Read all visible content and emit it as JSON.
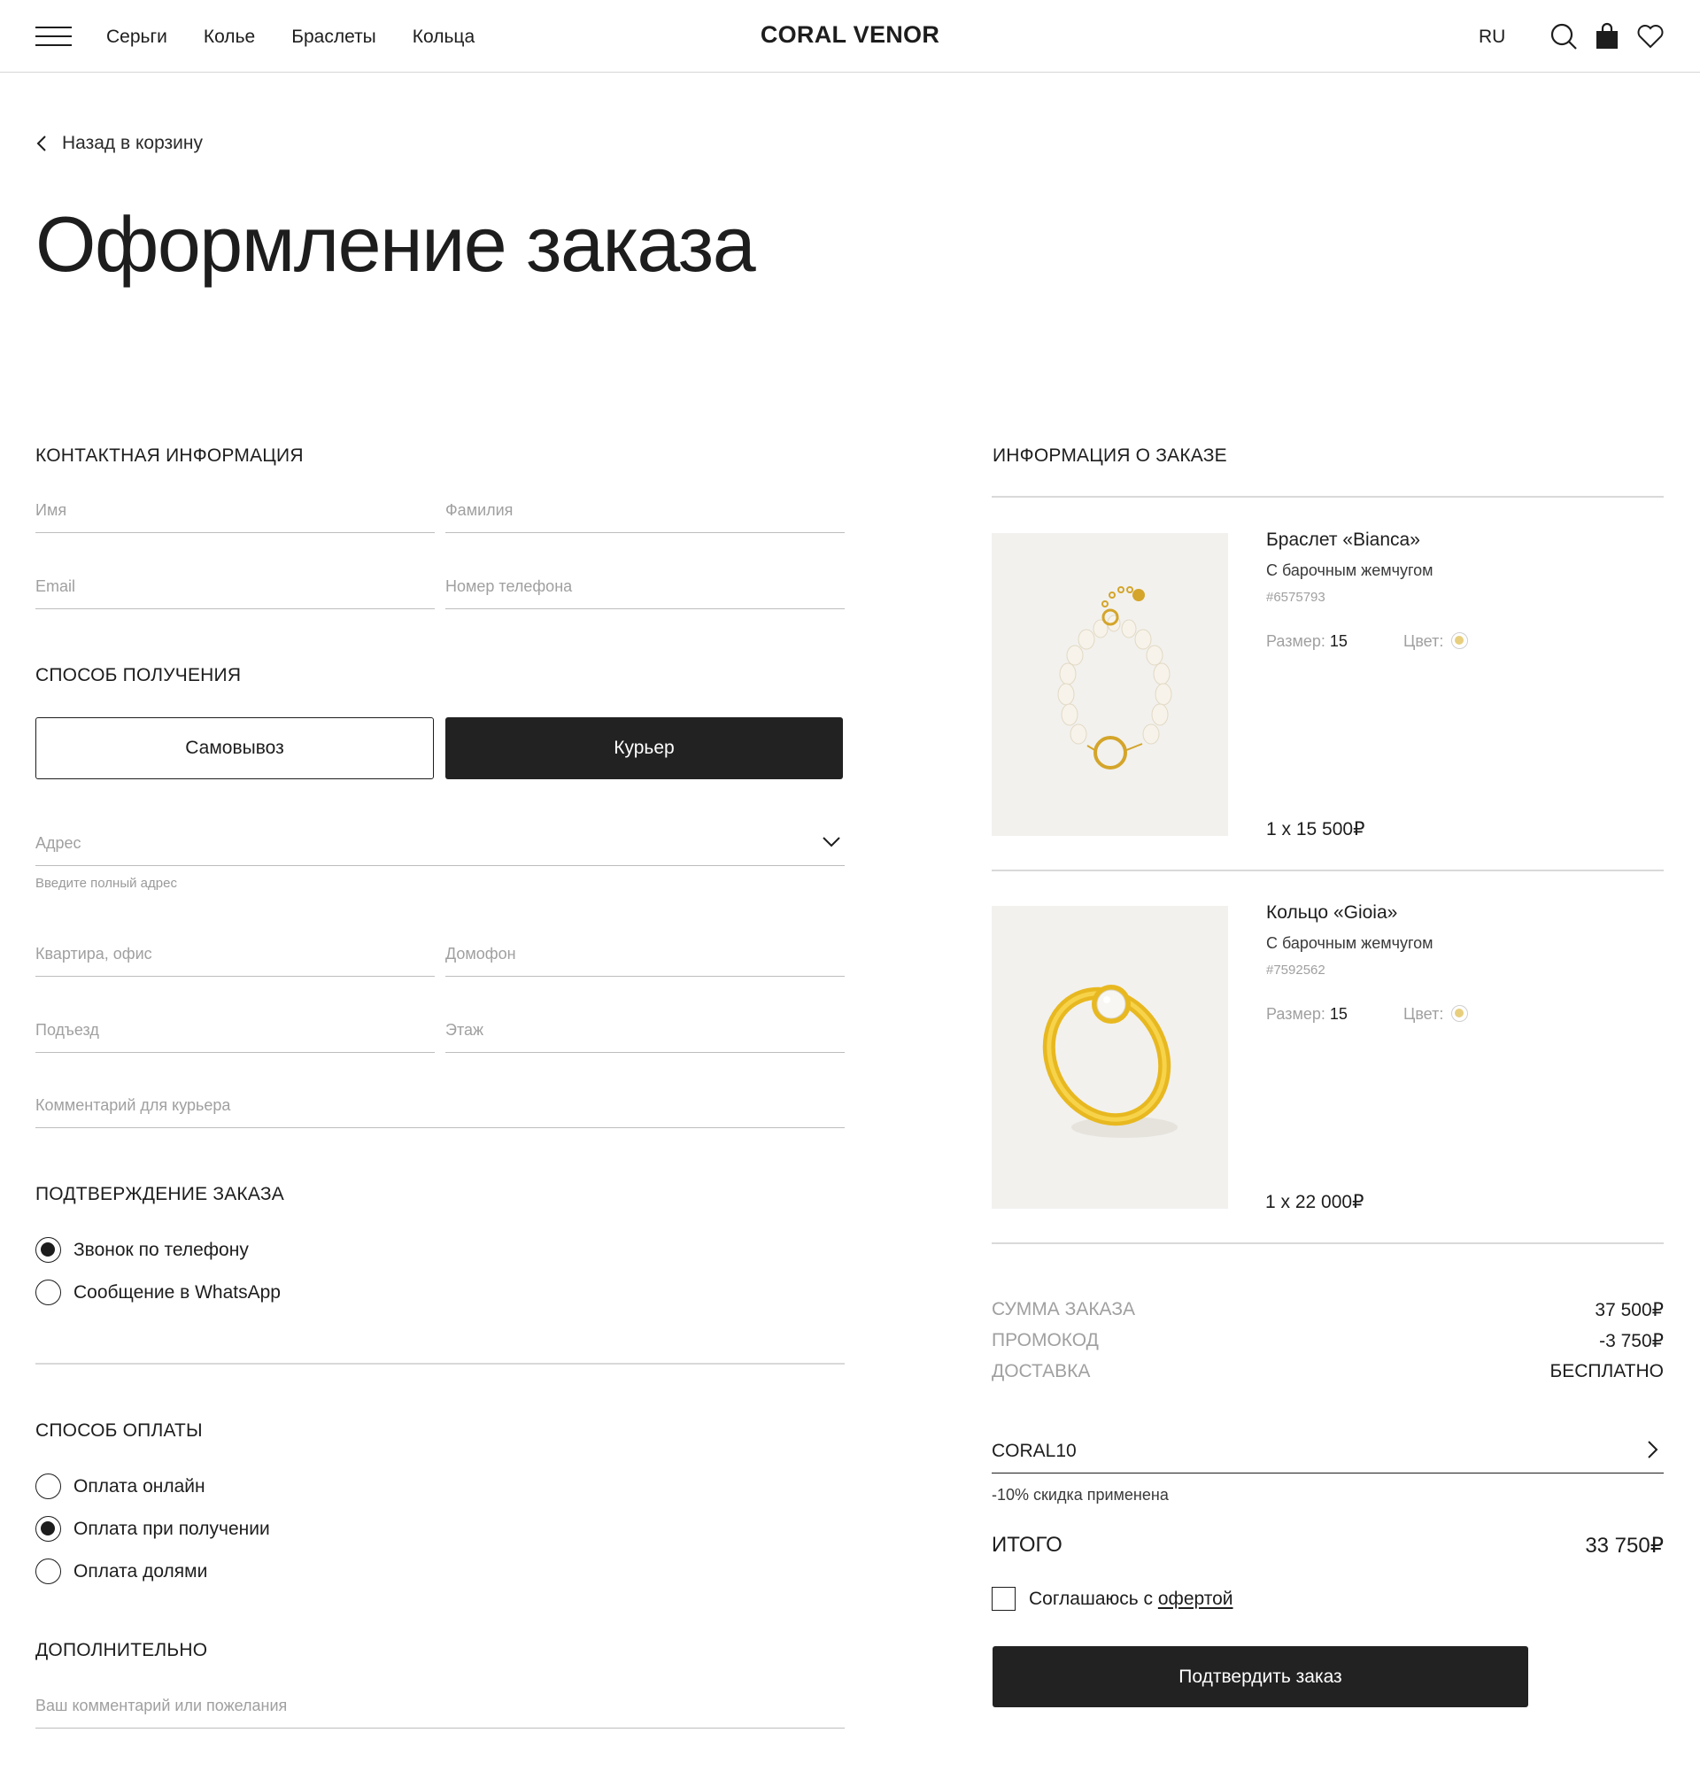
{
  "header": {
    "logo": "CORAL VENOR",
    "nav": [
      "Серьги",
      "Колье",
      "Браслеты",
      "Кольца"
    ],
    "language": "RU",
    "icons": [
      "menu-icon",
      "search-icon",
      "bag-icon",
      "heart-icon"
    ]
  },
  "back_link": "Назад в корзину",
  "page_title": "Оформление заказа",
  "contact": {
    "heading": "КОНТАКТНАЯ ИНФОРМАЦИЯ",
    "first_name_placeholder": "Имя",
    "last_name_placeholder": "Фамилия",
    "email_placeholder": "Email",
    "phone_placeholder": "Номер телефона"
  },
  "delivery": {
    "heading": "СПОСОБ ПОЛУЧЕНИЯ",
    "pickup_label": "Самовывоз",
    "courier_label": "Курьер",
    "selected": "Курьер",
    "address_placeholder": "Адрес",
    "address_hint": "Введите полный адрес",
    "apartment_placeholder": "Квартира, офис",
    "intercom_placeholder": "Домофон",
    "entrance_placeholder": "Подъезд",
    "floor_placeholder": "Этаж",
    "comment_placeholder": "Комментарий для курьера"
  },
  "confirmation": {
    "heading": "ПОДТВЕРЖДЕНИЕ ЗАКАЗА",
    "options": [
      {
        "label": "Звонок по телефону",
        "selected": true
      },
      {
        "label": "Сообщение в WhatsApp",
        "selected": false
      }
    ]
  },
  "payment": {
    "heading": "СПОСОБ ОПЛАТЫ",
    "options": [
      {
        "label": "Оплата онлайн",
        "selected": false
      },
      {
        "label": "Оплата при получении",
        "selected": true
      },
      {
        "label": "Оплата долями",
        "selected": false
      }
    ]
  },
  "additional": {
    "heading": "ДОПОЛНИТЕЛЬНО",
    "comment_placeholder": "Ваш комментарий или пожелания"
  },
  "order": {
    "heading": "ИНФОРМАЦИЯ О ЗАКАЗЕ",
    "items": [
      {
        "name": "Браслет «Bianca»",
        "description": "С барочным жемчугом",
        "sku": "#6575793",
        "size_label": "Размер:",
        "size": "15",
        "color_label": "Цвет:",
        "price": "1 x 15 500₽"
      },
      {
        "name": "Кольцо «Gioia»",
        "description": "С барочным жемчугом",
        "sku": "#7592562",
        "size_label": "Размер:",
        "size": "15",
        "color_label": "Цвет:",
        "price": "1 x 22 000₽"
      }
    ],
    "swatch_color": "#e8cf7e",
    "summary": {
      "subtotal_label": "СУММА ЗАКАЗА",
      "subtotal": "37 500₽",
      "promo_label": "ПРОМОКОД",
      "promo": "-3 750₽",
      "shipping_label": "ДОСТАВКА",
      "shipping": "БЕСПЛАТНО"
    },
    "promo_code": "CORAL10",
    "promo_note": "-10% скидка применена",
    "total_label": "ИТОГО",
    "total": "33 750₽",
    "agree_text": "Соглашаюсь с",
    "agree_link": "офертой",
    "submit_label": "Подтвердить заказ"
  },
  "colors": {
    "dark_button": "#222222",
    "text": "#1d1d1d",
    "muted": "#a0a0a0",
    "gold": "#e8cf7e"
  }
}
